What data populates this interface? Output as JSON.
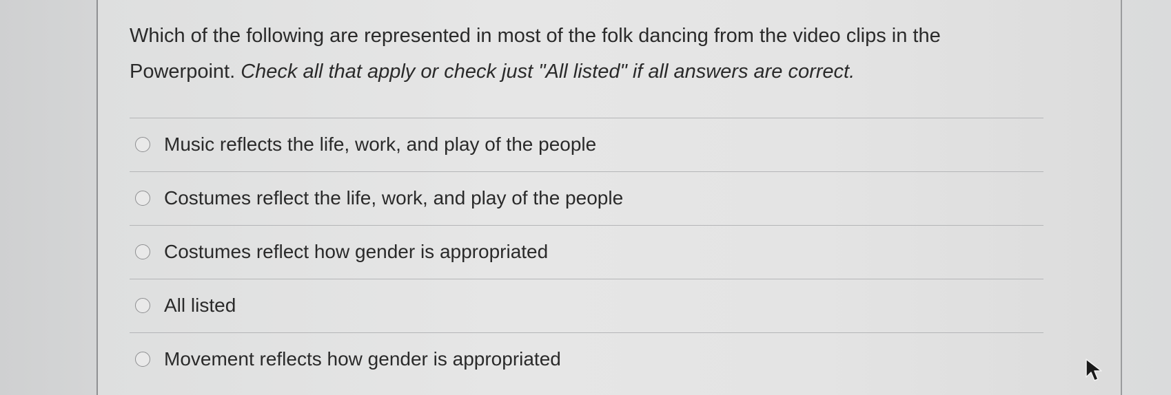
{
  "question": {
    "text_plain": "Which of the following are represented in most of the folk dancing from the video clips in the Powerpoint.",
    "text_italic": "Check all that apply or check just \"All listed\" if all answers are correct."
  },
  "options": [
    {
      "label": "Music reflects the life, work, and play of the people",
      "selected": false
    },
    {
      "label": "Costumes reflect the life, work, and play of the people",
      "selected": false
    },
    {
      "label": "Costumes reflect how gender is appropriated",
      "selected": false
    },
    {
      "label": "All listed",
      "selected": false
    },
    {
      "label": "Movement reflects how gender is appropriated",
      "selected": false
    }
  ],
  "icons": {
    "radio": "radio-unchecked-icon",
    "cursor": "mouse-pointer-icon"
  }
}
